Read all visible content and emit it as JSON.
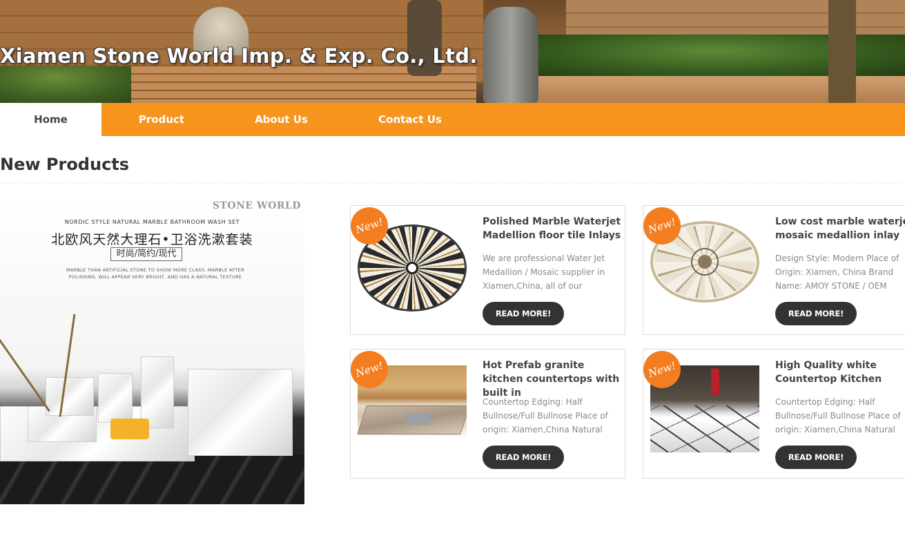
{
  "header": {
    "site_title": "Xiamen Stone World Imp. & Exp. Co., Ltd."
  },
  "nav": {
    "items": [
      {
        "label": "Home",
        "active": true
      },
      {
        "label": "Product",
        "active": false
      },
      {
        "label": "About Us",
        "active": false
      },
      {
        "label": "Contact Us",
        "active": false
      }
    ]
  },
  "section": {
    "title": "New Products"
  },
  "featured": {
    "heading": "NORDIC STYLE NATURAL MARBLE BATHROOM WASH SET",
    "chinese_title": "北欧风天然大理石•卫浴洗漱套装",
    "chinese_subtitle": "时尚/简约/现代",
    "description": "MARBLE THAN ARTIFICIAL STONE TO SHOW MORE CLASS, MARBLE AFTER POLISHING, WILL APPEAR VERY BRIGHT, AND HAS A NATURAL TEXTURE",
    "logo_text": "STONE WORLD"
  },
  "products": [
    {
      "badge": "New!",
      "title": "Polished Marble Waterjet Madellion floor tile Inlays",
      "description": "We are professional Water Jet Medallion / Mosaic supplier in Xiamen,China, all of our",
      "button": "READ MORE!",
      "thumb_icon": "marble-medallion-image"
    },
    {
      "badge": "New!",
      "title": "Low cost marble waterjet mosaic medallion inlay",
      "description": "Design Style: Modern Place of Origin: Xiamen, China Brand Name: AMOY STONE / OEM",
      "button": "READ MORE!",
      "thumb_icon": "mosaic-medallion-image"
    },
    {
      "badge": "New!",
      "title": "Hot Prefab granite kitchen countertops with built in",
      "description": "Countertop Edging: Half Bullnose/Full Bullnose Place of origin: Xiamen,China Natural",
      "button": "READ MORE!",
      "thumb_icon": "granite-countertop-image"
    },
    {
      "badge": "New!",
      "title": "High Quality white Countertop Kitchen",
      "description": "Countertop Edging: Half Bullnose/Full Bullnose Place of origin: Xiamen,China Natural",
      "button": "READ MORE!",
      "thumb_icon": "white-countertop-image"
    }
  ],
  "colors": {
    "nav_orange": "#f7941d",
    "badge_orange": "#f47d20",
    "button_dark": "#333333"
  }
}
